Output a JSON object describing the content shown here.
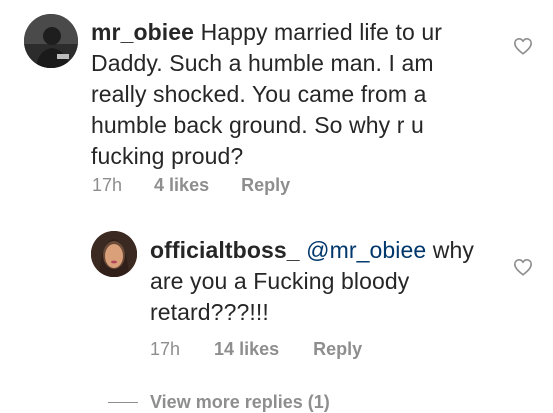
{
  "comments": [
    {
      "username": "mr_obiee",
      "mention": "",
      "text": "Happy married life to ur Daddy. Such a humble man. I am really shocked. You came from a humble back ground. So why r u fucking proud?",
      "time": "17h",
      "likes": "4 likes",
      "reply": "Reply"
    },
    {
      "username": "officialtboss_",
      "mention": "@mr_obiee",
      "text": "why are you a Fucking bloody retard???!!!",
      "time": "17h",
      "likes": "14 likes",
      "reply": "Reply"
    }
  ],
  "view_more": "View more replies (1)",
  "icons": {
    "like": "heart-outline-icon"
  },
  "colors": {
    "text": "#262626",
    "meta": "#8e8e8e",
    "mention": "#00376b"
  }
}
